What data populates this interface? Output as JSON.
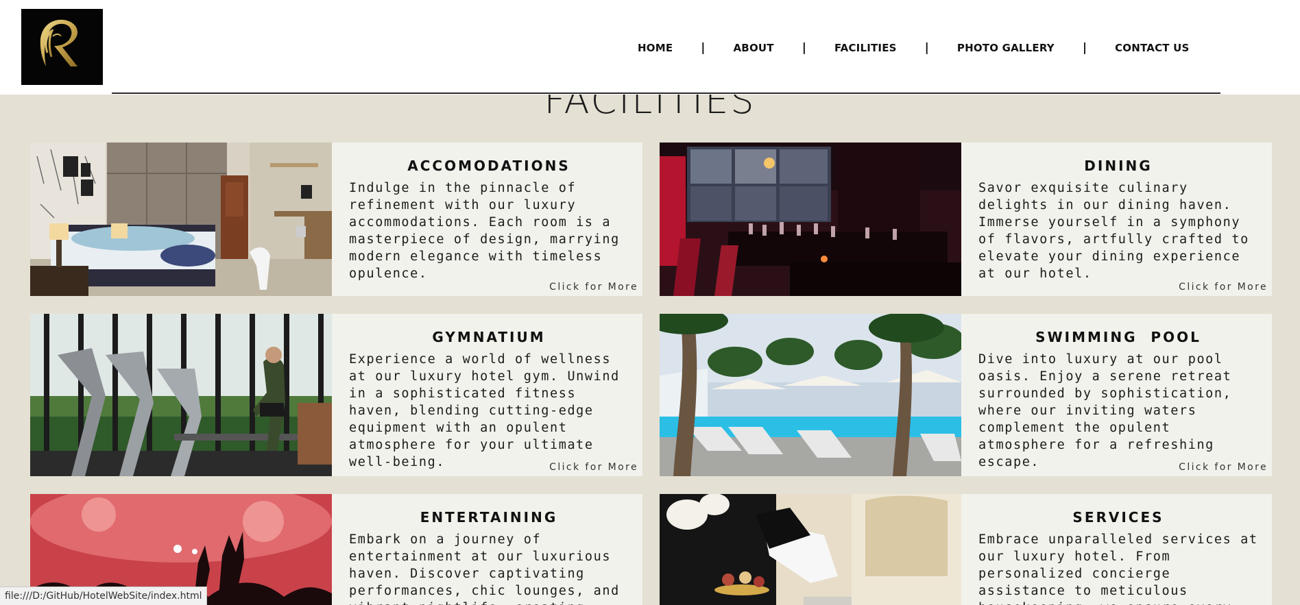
{
  "brand": {
    "logo_letter": "R",
    "accent_gold": "#c9a74f",
    "logo_bg": "#050505"
  },
  "nav": {
    "items": [
      "HOME",
      "ABOUT",
      "FACILITIES",
      "PHOTO GALLERY",
      "CONTACT US"
    ],
    "separator": "|"
  },
  "page": {
    "title": "FACILITIES",
    "background": "#e4e0d3"
  },
  "cards": [
    {
      "title": "ACCOMODATIONS",
      "text": "Indulge in the pinnacle of refinement with our luxury accommodations. Each room is a masterpiece of design, marrying modern elegance with timeless opulence.",
      "more": "Click for More",
      "image": "bedroom-photo"
    },
    {
      "title": "DINING",
      "text": "Savor exquisite culinary delights in our dining haven. Immerse yourself in a symphony of flavors, artfully crafted to elevate your dining experience at our hotel.",
      "more": "Click for More",
      "image": "restaurant-photo"
    },
    {
      "title": "GYMNATIUM",
      "text": "Experience a world of wellness at our luxury hotel gym. Unwind in a sophisticated fitness haven, blending cutting-edge equipment with an opulent atmosphere for your ultimate well-being.",
      "more": "Click for More",
      "image": "gym-photo"
    },
    {
      "title": "SWIMMING  POOL",
      "text": "Dive into luxury at our pool oasis. Enjoy a serene retreat surrounded by sophistication, where our inviting waters complement the opulent atmosphere for a refreshing escape.",
      "more": "Click for More",
      "image": "pool-photo"
    },
    {
      "title": "ENTERTAINING",
      "text": "Embark on a journey of entertainment at our luxurious haven. Discover captivating performances, chic lounges, and vibrant nightlife, creating",
      "more": "",
      "image": "concert-photo"
    },
    {
      "title": "SERVICES",
      "text": "Embrace unparalleled services at our luxury hotel. From personalized concierge assistance to meticulous housekeeping, we ensure every aspect of your stay",
      "more": "",
      "image": "room-service-photo"
    }
  ],
  "status_bar": {
    "url": "file:///D:/GitHub/HotelWebSite/index.html"
  }
}
